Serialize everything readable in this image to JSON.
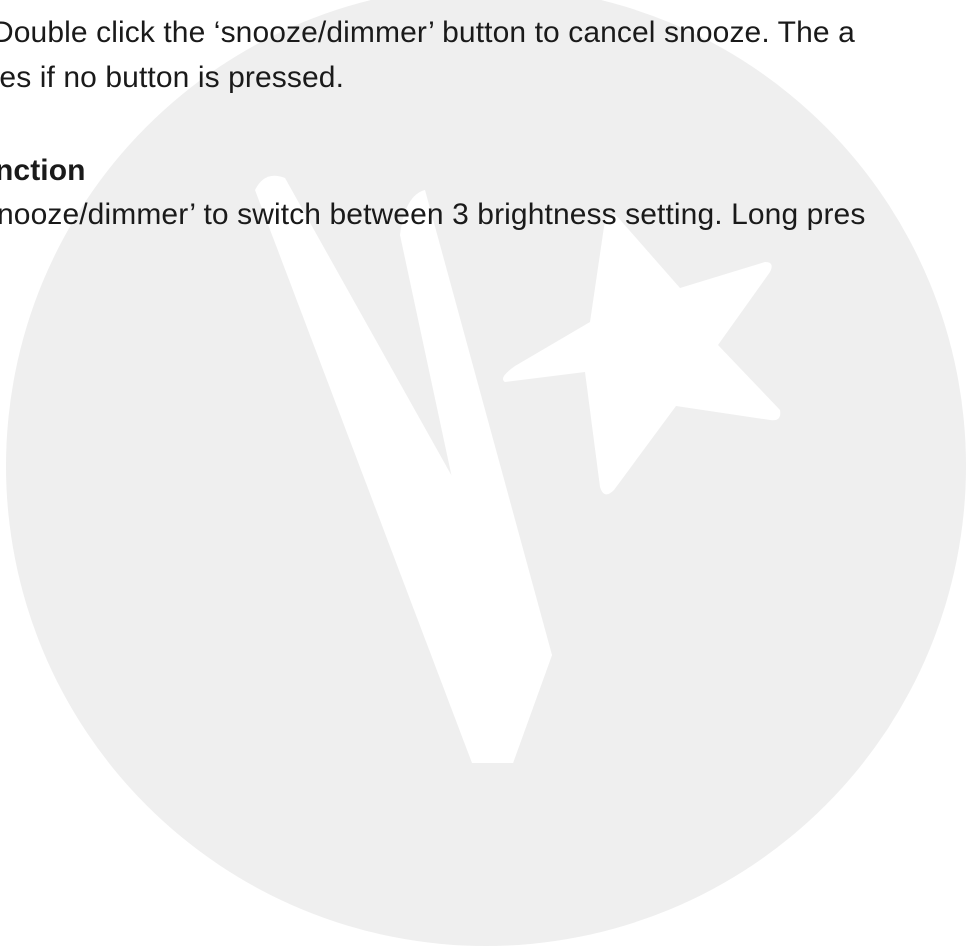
{
  "document": {
    "snooze_text_line1": "Double click the ‘snooze/dimmer’ button to cancel snooze. The a",
    "snooze_text_line2": "tes if no button is pressed.",
    "section_heading": "nction",
    "dimmer_text_line1": "nooze/dimmer’ to switch between 3 brightness setting. Long pres"
  },
  "watermark": {
    "logo_name": "brand-logo-v-star",
    "circle_color": "#efefef",
    "shape_color": "#ffffff"
  }
}
